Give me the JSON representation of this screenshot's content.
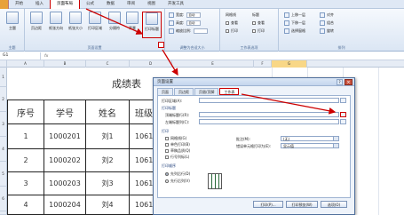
{
  "menu": {
    "tabs": [
      "开始",
      "插入",
      "页面布局",
      "公式",
      "数据",
      "审阅",
      "视图",
      "开发工具"
    ],
    "active_tab": "页面布局"
  },
  "ribbon": {
    "group_theme": {
      "button": "主题",
      "label": "主题"
    },
    "group_page_setup": {
      "buttons": [
        "页边距",
        "纸张方向",
        "纸张大小",
        "打印区域",
        "分隔符",
        "背景",
        "打印标题"
      ],
      "label": "页面设置"
    },
    "group_scale": {
      "rows": [
        {
          "label": "宽度:",
          "value": "自动"
        },
        {
          "label": "高度:",
          "value": "自动"
        },
        {
          "label": "缩放比例:",
          "value": ""
        }
      ],
      "label": "调整为合适大小"
    },
    "group_sheet_options": {
      "col1": [
        "网格线",
        "查看",
        "打印"
      ],
      "col2": [
        "标题",
        "查看",
        "打印"
      ],
      "label": "工作表选项"
    },
    "group_arrange": {
      "rows": [
        "上移一层",
        "下移一层",
        "选择窗格"
      ],
      "extra": [
        "对齐",
        "组合",
        "旋转"
      ],
      "label": "排列"
    }
  },
  "formula_bar": {
    "name_box": "G1",
    "fx": "fx"
  },
  "columns": [
    "A",
    "B",
    "C",
    "D",
    "E",
    "F",
    "G"
  ],
  "sheet": {
    "title": "成绩表",
    "headers": [
      "序号",
      "学号",
      "姓名",
      "班级"
    ],
    "rows": [
      {
        "no": "1",
        "id": "1000201",
        "name": "刘1",
        "cls": "1061"
      },
      {
        "no": "2",
        "id": "1000202",
        "name": "刘2",
        "cls": "1061"
      },
      {
        "no": "3",
        "id": "1000203",
        "name": "刘3",
        "cls": "1061"
      },
      {
        "no": "4",
        "id": "1000204",
        "name": "刘4",
        "cls": "1061"
      }
    ],
    "row_numbers": [
      "1",
      "2",
      "3",
      "4",
      "5",
      "6",
      "7"
    ]
  },
  "dialog": {
    "title": "页面设置",
    "help": "?",
    "close": "×",
    "tabs": [
      "页面",
      "页边距",
      "页眉/页脚",
      "工作表"
    ],
    "active_tab": "工作表",
    "print_area_label": "打印区域(A):",
    "print_titles_label": "打印标题",
    "top_rows_label": "顶端标题行(R):",
    "left_cols_label": "左端标题列(C):",
    "print_section": "打印",
    "print_checks": [
      "网格线(G)",
      "单色打印(B)",
      "草稿品质(Q)",
      "行号列标(L)"
    ],
    "comments_label": "批注(M):",
    "comments_value": "(无)",
    "errors_label": "错误单元格打印为(E):",
    "errors_value": "显示值",
    "order_section": "打印顺序",
    "order_options": [
      "先列后行(D)",
      "先行后列(V)"
    ],
    "buttons": [
      "打印(P)...",
      "打印预览(W)",
      "选项(O)"
    ]
  },
  "colors": {
    "accent_red": "#cc0000",
    "ribbon_blue": "#dbe6f4",
    "selected_col": "#f8d787"
  }
}
